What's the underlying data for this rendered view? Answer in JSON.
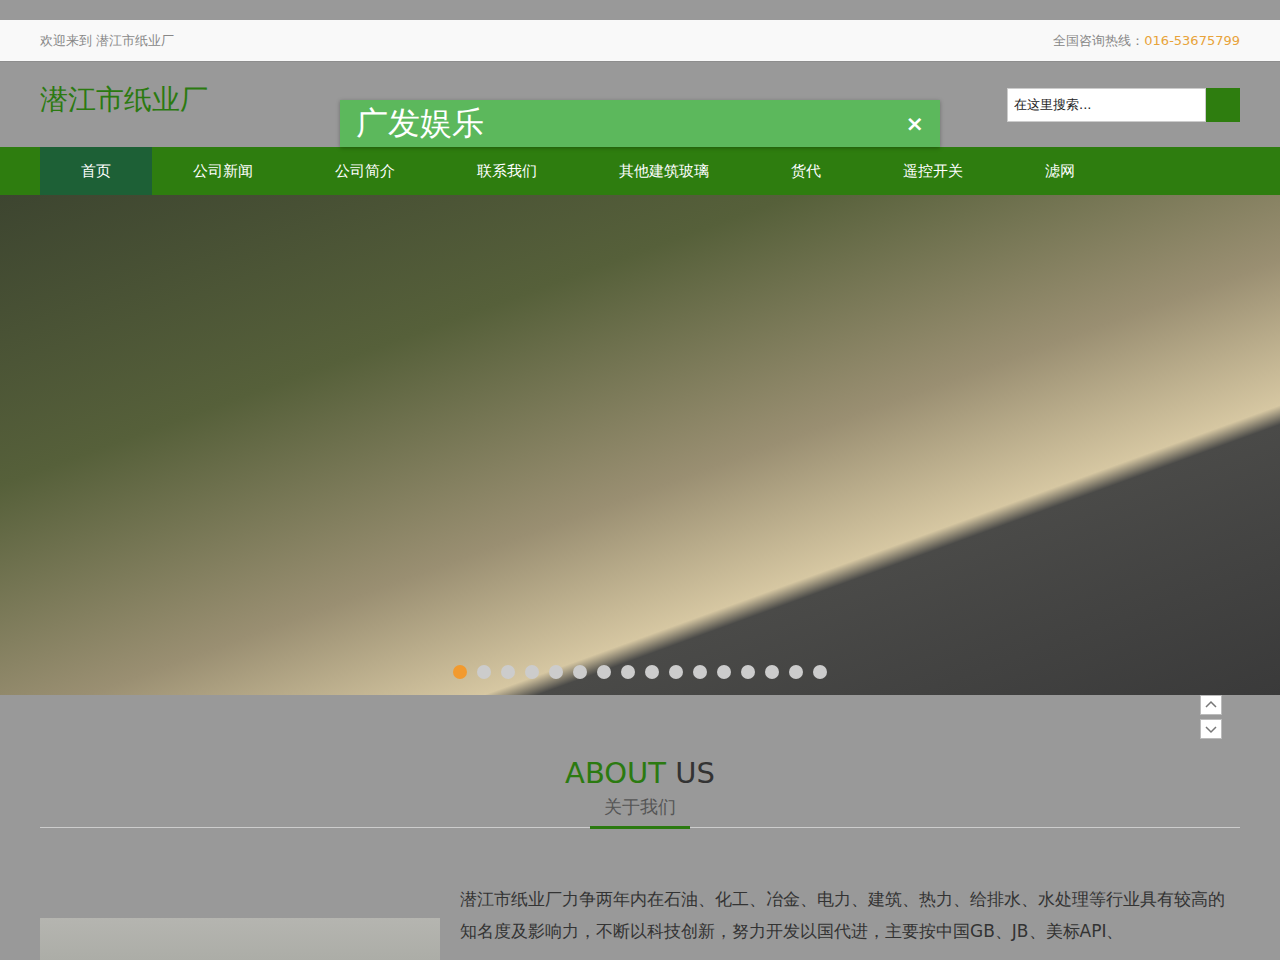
{
  "topbar": {
    "welcome": "欢迎来到 潜江市纸业厂",
    "hotline_label": "全国咨询热线：",
    "hotline_number": "016-53675799"
  },
  "header": {
    "logo": "潜江市纸业厂"
  },
  "search": {
    "placeholder": "在这里搜索..."
  },
  "popup": {
    "title": "广发娱乐",
    "close": "×"
  },
  "nav": [
    {
      "label": "首页",
      "selected": true
    },
    {
      "label": "公司新闻",
      "selected": false
    },
    {
      "label": "公司简介",
      "selected": false
    },
    {
      "label": "联系我们",
      "selected": false
    },
    {
      "label": "其他建筑玻璃",
      "selected": false
    },
    {
      "label": "货代",
      "selected": false
    },
    {
      "label": "遥控开关",
      "selected": false
    },
    {
      "label": "滤网",
      "selected": false
    }
  ],
  "carousel": {
    "dots": [
      {
        "selected": true
      },
      {
        "selected": false
      },
      {
        "selected": false
      },
      {
        "selected": false
      },
      {
        "selected": false
      },
      {
        "selected": false
      },
      {
        "selected": false
      },
      {
        "selected": false
      },
      {
        "selected": false
      },
      {
        "selected": false
      },
      {
        "selected": false
      },
      {
        "selected": false
      },
      {
        "selected": false
      },
      {
        "selected": false
      },
      {
        "selected": false
      },
      {
        "selected": false
      }
    ]
  },
  "about": {
    "title_main": "ABOUT",
    "title_rest": "US",
    "subtitle": "关于我们",
    "body": "潜江市纸业厂力争两年内在石油、化工、冶金、电力、建筑、热力、给排水、水处理等行业具有较高的知名度及影响力，不断以科技创新，努力开发以国代进，主要按中国GB、JB、美标API、"
  }
}
